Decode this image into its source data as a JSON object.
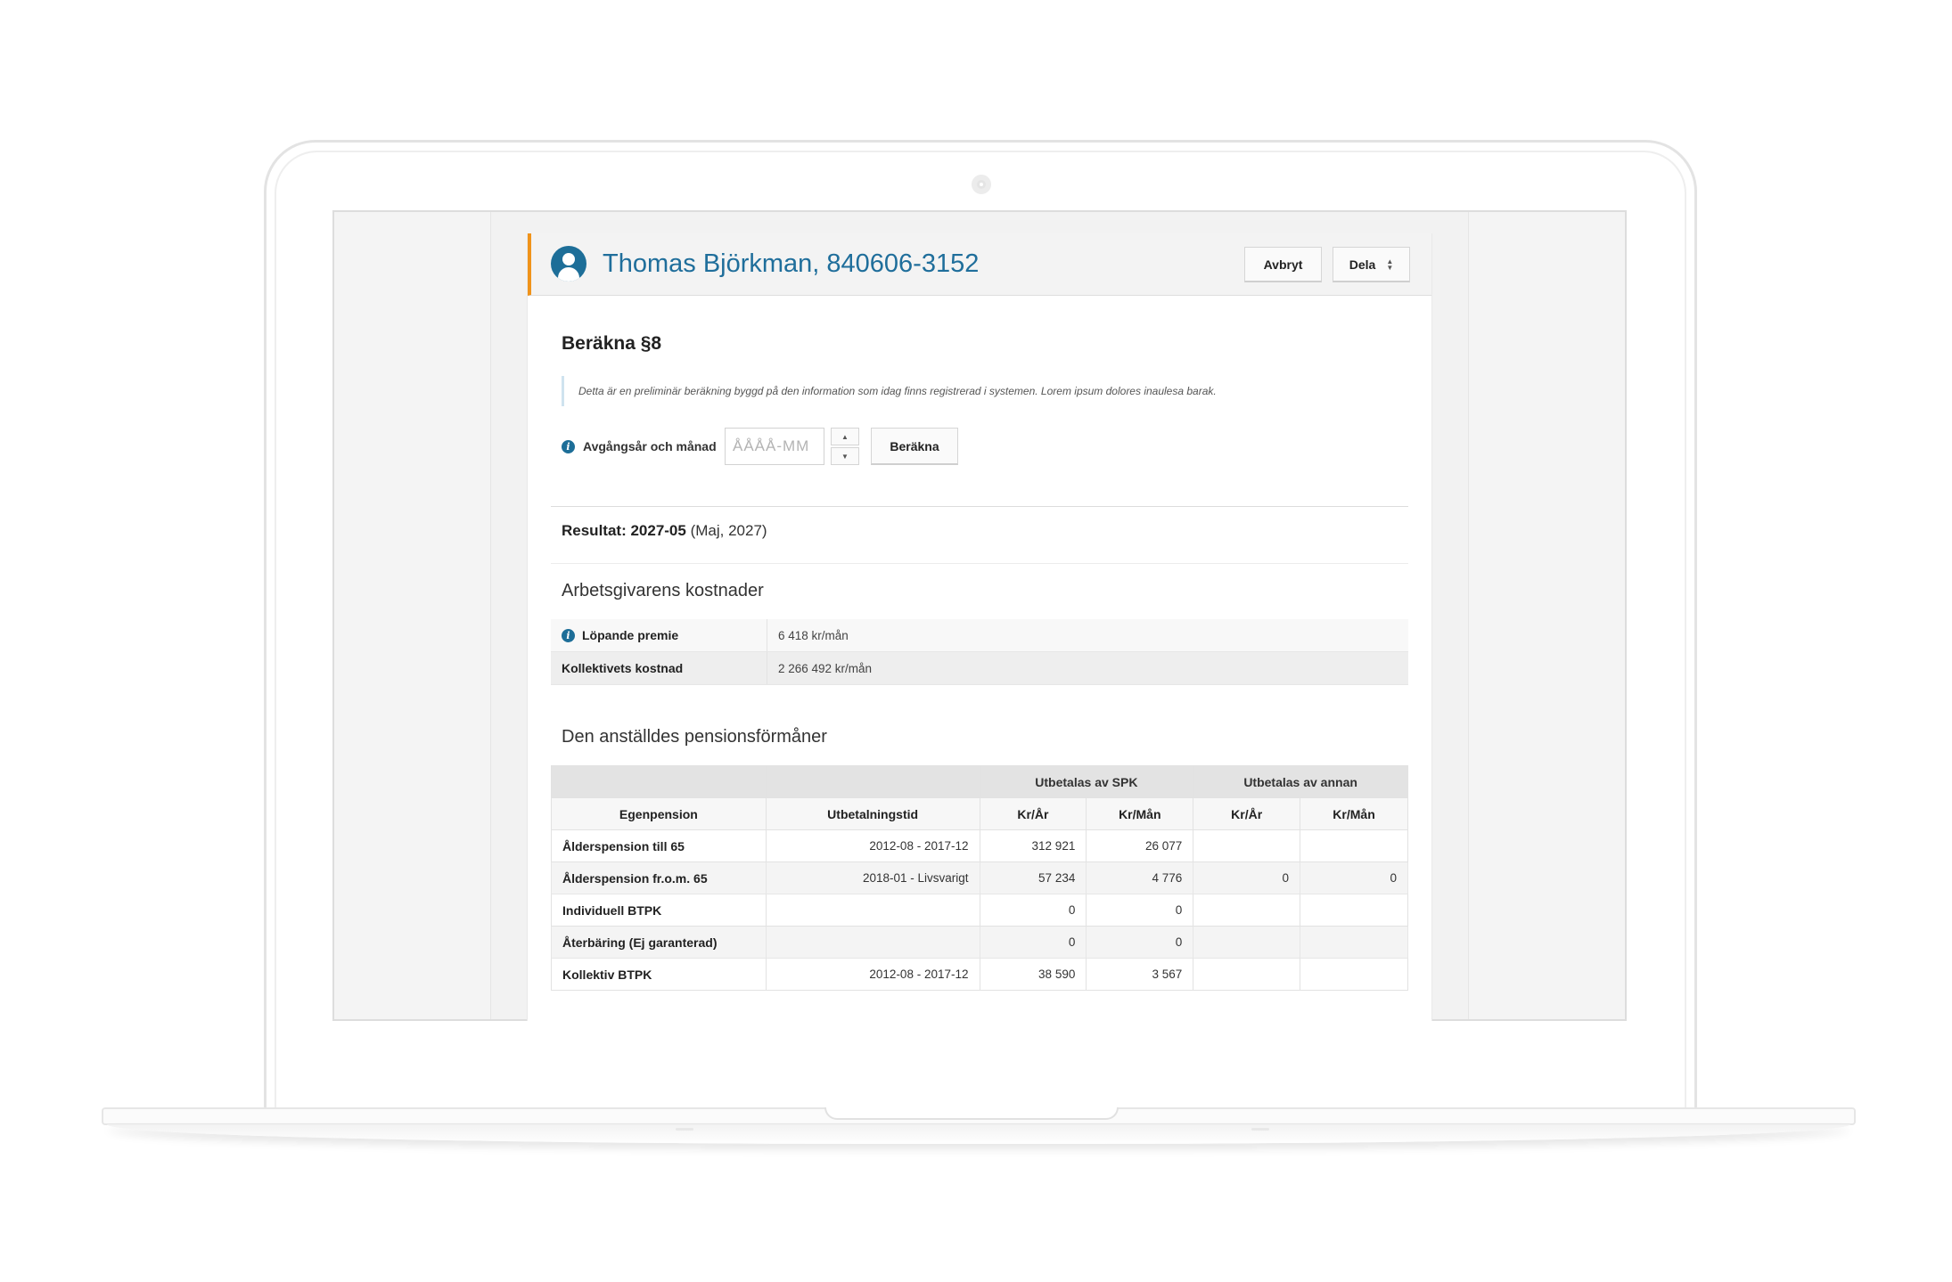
{
  "header": {
    "title": "Thomas Björkman, 840606-3152",
    "cancel_label": "Avbryt",
    "share_label": "Dela"
  },
  "calc": {
    "title": "Beräkna §8",
    "disclaimer": "Detta är en preliminär beräkning byggd på den information som idag finns registrerad i systemen. Lorem ipsum dolores inaulesa barak.",
    "field_label": "Avgångsår och månad",
    "field_placeholder": "ÅÅÅÅ-MM",
    "field_value": "",
    "stepper_up": "▲",
    "stepper_down": "▼",
    "calc_button": "Beräkna"
  },
  "result": {
    "label": "Resultat: 2027-05",
    "detail": "(Maj, 2027)"
  },
  "employer_costs": {
    "title": "Arbetsgivarens kostnader",
    "rows": [
      {
        "label": "Löpande premie",
        "value": "6 418 kr/mån"
      },
      {
        "label": "Kollektivets kostnad",
        "value": "2 266 492 kr/mån"
      }
    ]
  },
  "benefits": {
    "title": "Den anställdes pensionsförmåner",
    "group_headers": [
      "",
      "",
      "Utbetalas av SPK",
      "Utbetalas av annan"
    ],
    "columns": [
      "Egenpension",
      "Utbetalningstid",
      "Kr/År",
      "Kr/Mån",
      "Kr/År",
      "Kr/Mån"
    ],
    "rows": [
      [
        "Ålderspension till 65",
        "2012-08 - 2017-12",
        "312 921",
        "26 077",
        "",
        ""
      ],
      [
        "Ålderspension fr.o.m. 65",
        "2018-01 - Livsvarigt",
        "57 234",
        "4 776",
        "0",
        "0"
      ],
      [
        "Individuell BTPK",
        "",
        "0",
        "0",
        "",
        ""
      ],
      [
        "Återbäring (Ej garanterad)",
        "",
        "0",
        "0",
        "",
        ""
      ],
      [
        "Kollektiv BTPK",
        "2012-08 - 2017-12",
        "38 590",
        "3 567",
        "",
        ""
      ]
    ]
  },
  "colors": {
    "accent_blue": "#1f6e9b",
    "accent_orange": "#f0931a"
  },
  "icons": {
    "avatar": "user-avatar-icon",
    "info": "info-icon",
    "select": "select-arrows-icon"
  }
}
